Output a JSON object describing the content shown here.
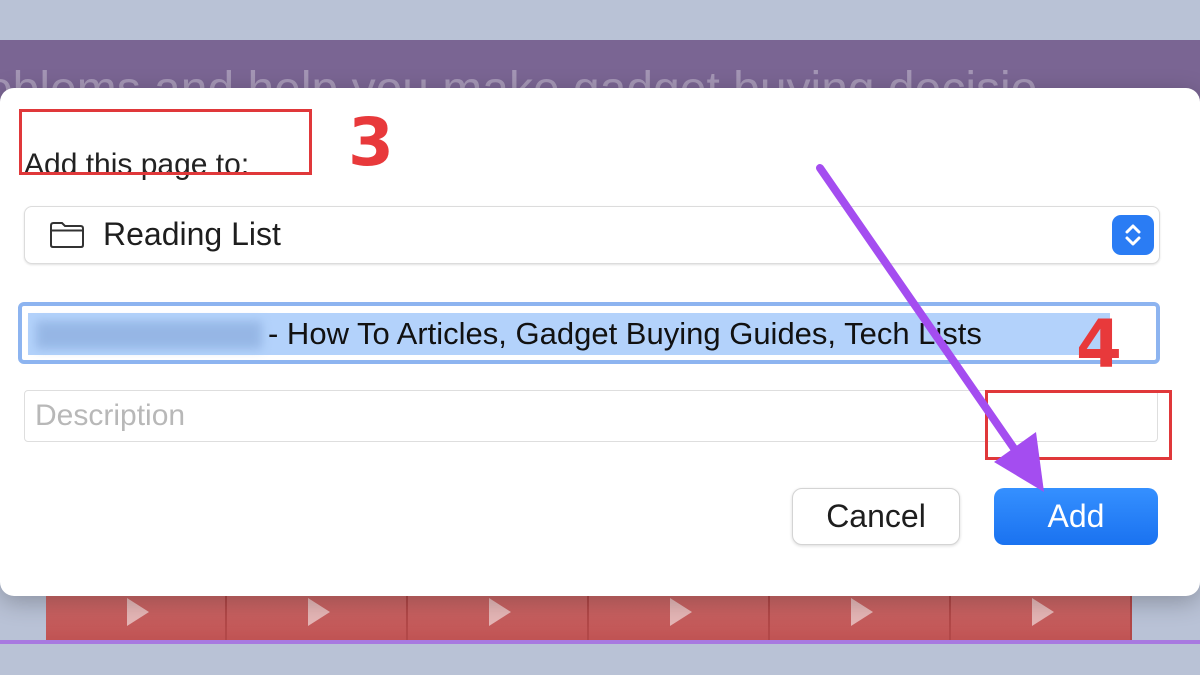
{
  "background": {
    "overlay_text": "roblems and help you make gadget buying decisio"
  },
  "dialog": {
    "prompt_label": "Add this page to:",
    "folder": {
      "selected": "Reading List",
      "icon": "folder-icon"
    },
    "title_field": {
      "value": "- How To Articles, Gadget Buying Guides, Tech Lists",
      "selected": true
    },
    "description_field": {
      "value": "",
      "placeholder": "Description"
    },
    "buttons": {
      "cancel": "Cancel",
      "add": "Add"
    }
  },
  "annotations": {
    "step_3": "3",
    "step_4": "4",
    "highlight_color": "#e0383a",
    "arrow_color": "#a44df0"
  },
  "colors": {
    "accent": "#2a7cf4",
    "selection": "#b3d2fb",
    "focus_ring": "#8db4f0"
  }
}
